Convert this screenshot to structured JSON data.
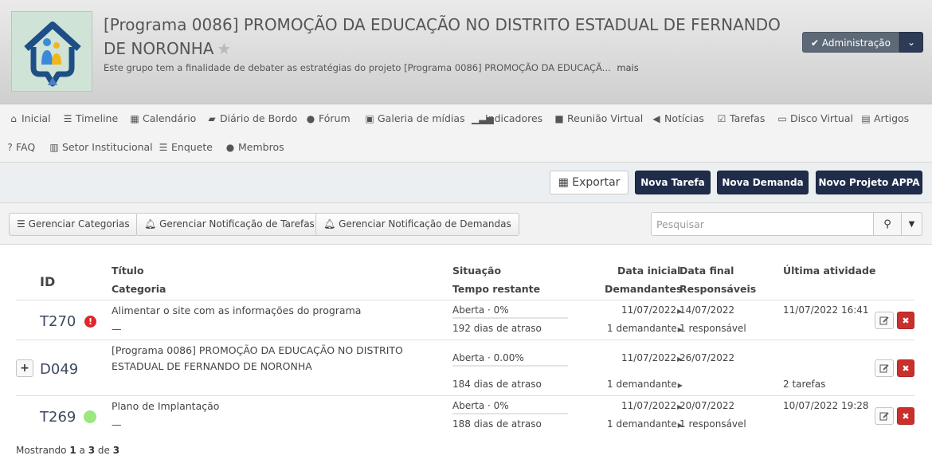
{
  "header": {
    "title": "[Programa 0086] PROMOÇÃO DA EDUCAÇÃO NO DISTRITO ESTADUAL DE FERNANDO DE NORONHA",
    "subtitle": "Este grupo tem a finalidade de debater as estratégias do projeto [Programa 0086] PROMOÇÃO DA EDUCAÇÃ...",
    "more_link": "mais",
    "admin_label": "Administração"
  },
  "nav": {
    "items": [
      {
        "label": "Inicial",
        "icon": "home-icon"
      },
      {
        "label": "Timeline",
        "icon": "list-icon"
      },
      {
        "label": "Calendário",
        "icon": "calendar-icon"
      },
      {
        "label": "Diário de Bordo",
        "icon": "book-icon"
      },
      {
        "label": "Fórum",
        "icon": "comments-icon"
      },
      {
        "label": "Galeria de mídias",
        "icon": "image-icon"
      },
      {
        "label": "Indicadores",
        "icon": "signal-icon"
      },
      {
        "label": "Reunião Virtual",
        "icon": "video-icon"
      },
      {
        "label": "Notícias",
        "icon": "bullhorn-icon"
      },
      {
        "label": "Tarefas",
        "icon": "checkbox-icon"
      },
      {
        "label": "Disco Virtual",
        "icon": "hdd-icon"
      },
      {
        "label": "Artigos",
        "icon": "newspaper-icon"
      },
      {
        "label": "FAQ",
        "icon": "question-icon"
      },
      {
        "label": "Setor Institucional",
        "icon": "building-icon"
      },
      {
        "label": "Enquete",
        "icon": "list-icon"
      },
      {
        "label": "Membros",
        "icon": "user-icon"
      }
    ]
  },
  "actions": {
    "export": "Exportar",
    "new_task": "Nova Tarefa",
    "new_demand": "Nova Demanda",
    "new_project": "Novo Projeto APPA"
  },
  "filters": {
    "categories": "Gerenciar Categorias",
    "task_notif": "Gerenciar Notificação de Tarefas",
    "demand_notif": "Gerenciar Notificação de Demandas",
    "search_placeholder": "Pesquisar"
  },
  "table": {
    "headers": {
      "id": "ID",
      "title": "Título",
      "category": "Categoria",
      "status": "Situação",
      "remaining": "Tempo restante",
      "start": "Data inicial",
      "demanders": "Demandantes",
      "end": "Data final",
      "responsible": "Responsáveis",
      "last": "Última atividade"
    },
    "rows": [
      {
        "id": "T270",
        "title": "Alimentar o site com as informações do programa",
        "category": "—",
        "status": "Aberta · 0%",
        "remaining": "192 dias de atraso",
        "start": "11/07/2022",
        "demanders": "1 demandante",
        "end": "14/07/2022",
        "responsible": "1 responsável",
        "last": "11/07/2022 16:41",
        "progress": 0
      },
      {
        "id": "D049",
        "title": "[Programa 0086] PROMOÇÃO DA EDUCAÇÃO NO DISTRITO ESTADUAL DE FERNANDO DE NORONHA",
        "category": "",
        "status": "Aberta · 0.00%",
        "remaining": "184 dias de atraso",
        "start": "11/07/2022",
        "demanders": "1 demandante",
        "end": "26/07/2022",
        "responsible": "",
        "last": "2 tarefas",
        "progress": 0
      },
      {
        "id": "T269",
        "title": "Plano de Implantação",
        "category": "—",
        "status": "Aberta · 0%",
        "remaining": "188 dias de atraso",
        "start": "11/07/2022",
        "demanders": "1 demandante",
        "end": "20/07/2022",
        "responsible": "1 responsável",
        "last": "10/07/2022 19:28",
        "progress": 0
      }
    ]
  },
  "footer": {
    "prefix": "Mostrando",
    "from": "1",
    "sep1": "a",
    "to": "3",
    "sep2": "de",
    "total": "3"
  },
  "colors": {
    "primary_dark": "#1f2d4a",
    "danger": "#c9302c",
    "status_ok": "#9be87f",
    "status_error": "#e0262a"
  }
}
